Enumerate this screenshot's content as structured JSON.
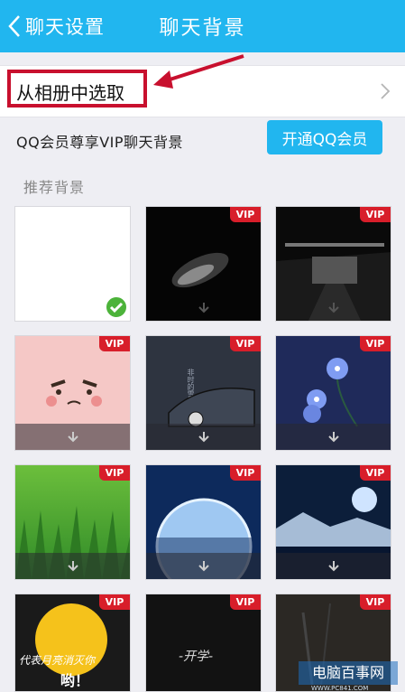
{
  "header": {
    "back_label": "聊天设置",
    "title": "聊天背景"
  },
  "album": {
    "label": "从相册中选取"
  },
  "vip_row": {
    "text": "QQ会员尊享VIP聊天背景",
    "button": "开通QQ会员"
  },
  "section": {
    "title": "推荐背景"
  },
  "tiles": [
    {
      "name": "default",
      "vip": "",
      "selected": true
    },
    {
      "name": "dark-car",
      "vip": "VIP"
    },
    {
      "name": "dark-garage",
      "vip": "VIP"
    },
    {
      "name": "pink-face",
      "vip": "VIP"
    },
    {
      "name": "sleeping-girl",
      "vip": "VIP"
    },
    {
      "name": "blue-flowers",
      "vip": "VIP"
    },
    {
      "name": "grass",
      "vip": "VIP"
    },
    {
      "name": "moon-planet",
      "vip": "VIP"
    },
    {
      "name": "mountain-moon",
      "vip": "VIP"
    },
    {
      "name": "yellow-moon",
      "vip": "VIP"
    },
    {
      "name": "dark-text",
      "vip": "VIP"
    },
    {
      "name": "dark-photo",
      "vip": "VIP"
    }
  ],
  "tile_texts": {
    "sleeping_text": "非时的雪",
    "calligraphy": "代表月亮消灭你",
    "calligraphy2": "哟！",
    "kaixue": "-开学-"
  },
  "watermark": {
    "main": "电脑百事网",
    "sub": "WWW.PC841.COM"
  },
  "colors": {
    "header": "#21b6ef",
    "vip_badge": "#d81e2a",
    "highlight_box": "#c8102e",
    "check": "#4cb33a"
  }
}
